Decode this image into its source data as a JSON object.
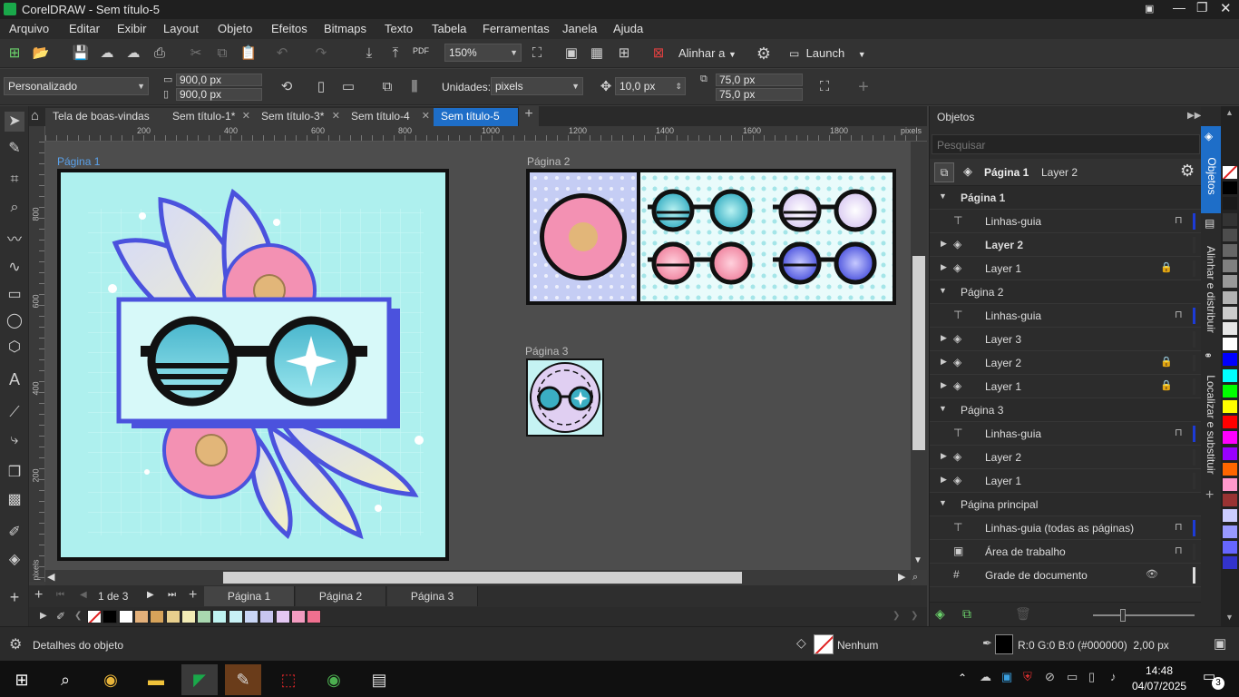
{
  "window": {
    "title": "CorelDRAW - Sem título-5"
  },
  "menu": [
    "Arquivo",
    "Editar",
    "Exibir",
    "Layout",
    "Objeto",
    "Efeitos",
    "Bitmaps",
    "Texto",
    "Tabela",
    "Ferramentas",
    "Janela",
    "Ajuda"
  ],
  "toolbar": {
    "zoom": "150%",
    "align_label": "Alinhar a",
    "launch_label": "Launch",
    "pdf": "PDF"
  },
  "propbar": {
    "preset": "Personalizado",
    "width": "900,0 px",
    "height": "900,0 px",
    "units_label": "Unidades:",
    "units_value": "pixels",
    "nudge": "10,0 px",
    "dup_x": "75,0 px",
    "dup_y": "75,0 px"
  },
  "doc_tabs": [
    {
      "label": "Tela de boas-vindas"
    },
    {
      "label": "Sem título-1*"
    },
    {
      "label": "Sem título-3*"
    },
    {
      "label": "Sem título-4"
    },
    {
      "label": "Sem título-5",
      "active": true
    }
  ],
  "ruler": {
    "h": [
      "200",
      "400",
      "600",
      "800",
      "1000",
      "1200",
      "1400",
      "1600",
      "1800"
    ],
    "h_unit": "pixels",
    "v": [
      "800",
      "600",
      "400",
      "200"
    ],
    "v_unit": "pixels"
  },
  "pages_canvas": {
    "p1": "Página 1",
    "p2": "Página 2",
    "p3": "Página 3"
  },
  "page_nav": {
    "counter": "1 de 3",
    "tabs": [
      "Página 1",
      "Página 2",
      "Página 3"
    ]
  },
  "palette_bottom": [
    "#ffffff",
    "#000000",
    "#ffffff",
    "#e3b07a",
    "#d7a35a",
    "#e8cf8d",
    "#f1ebb5",
    "#a9d8b0",
    "#bff3f0",
    "#c8f1f5",
    "#c9d6f5",
    "#c7c5ef",
    "#e3c7f2",
    "#f39cc0",
    "#f0708f"
  ],
  "objects_panel": {
    "title": "Objetos",
    "search_placeholder": "Pesquisar",
    "current_page": "Página 1",
    "current_layer": "Layer 2",
    "rows": [
      {
        "type": "page",
        "label": "Página 1",
        "bold": true
      },
      {
        "type": "guides",
        "label": "Linhas-guia",
        "bar": "#1d3bd6"
      },
      {
        "type": "layer",
        "label": "Layer 2",
        "bold": true,
        "bar": "#303030"
      },
      {
        "type": "layer",
        "label": "Layer 1",
        "locked": true,
        "bar": "#303030"
      },
      {
        "type": "page",
        "label": "Página 2"
      },
      {
        "type": "guides",
        "label": "Linhas-guia",
        "bar": "#1d3bd6"
      },
      {
        "type": "layer",
        "label": "Layer 3",
        "bar": "#303030"
      },
      {
        "type": "layer",
        "label": "Layer 2",
        "locked": true,
        "bar": "#303030"
      },
      {
        "type": "layer",
        "label": "Layer 1",
        "locked": true,
        "bar": "#303030"
      },
      {
        "type": "page",
        "label": "Página 3"
      },
      {
        "type": "guides",
        "label": "Linhas-guia",
        "bar": "#1d3bd6"
      },
      {
        "type": "layer",
        "label": "Layer 2",
        "bar": "#303030"
      },
      {
        "type": "layer",
        "label": "Layer 1",
        "bar": "#303030"
      },
      {
        "type": "page",
        "label": "Página principal"
      },
      {
        "type": "guides",
        "label": "Linhas-guia (todas as páginas)",
        "bar": "#1d3bd6"
      },
      {
        "type": "desktop",
        "label": "Área de trabalho",
        "bar": "#303030"
      },
      {
        "type": "grid",
        "label": "Grade de documento",
        "bar": "#dddddd"
      }
    ]
  },
  "side_tabs": [
    "Objetos",
    "Alinhar e distribuir",
    "Localizar e substituir"
  ],
  "right_palette": [
    "#ffffff",
    "#000000",
    "#1a1a1a",
    "#333333",
    "#4d4d4d",
    "#666666",
    "#808080",
    "#999999",
    "#b3b3b3",
    "#cccccc",
    "#e6e6e6",
    "#ffffff",
    "#0000ff",
    "#00ffff",
    "#00ff00",
    "#ffff00",
    "#ff0000",
    "#ff00ff",
    "#9900ff",
    "#ff6600",
    "#ff99cc",
    "#993333",
    "#ccccff",
    "#9999ff",
    "#6666ff",
    "#3333cc"
  ],
  "status": {
    "left": "Detalhes do objeto",
    "fill": "Nenhum",
    "outline": "R:0 G:0 B:0 (#000000)  2,00 px"
  },
  "taskbar": {
    "time": "14:48",
    "date": "04/07/2025",
    "badge": "3"
  }
}
